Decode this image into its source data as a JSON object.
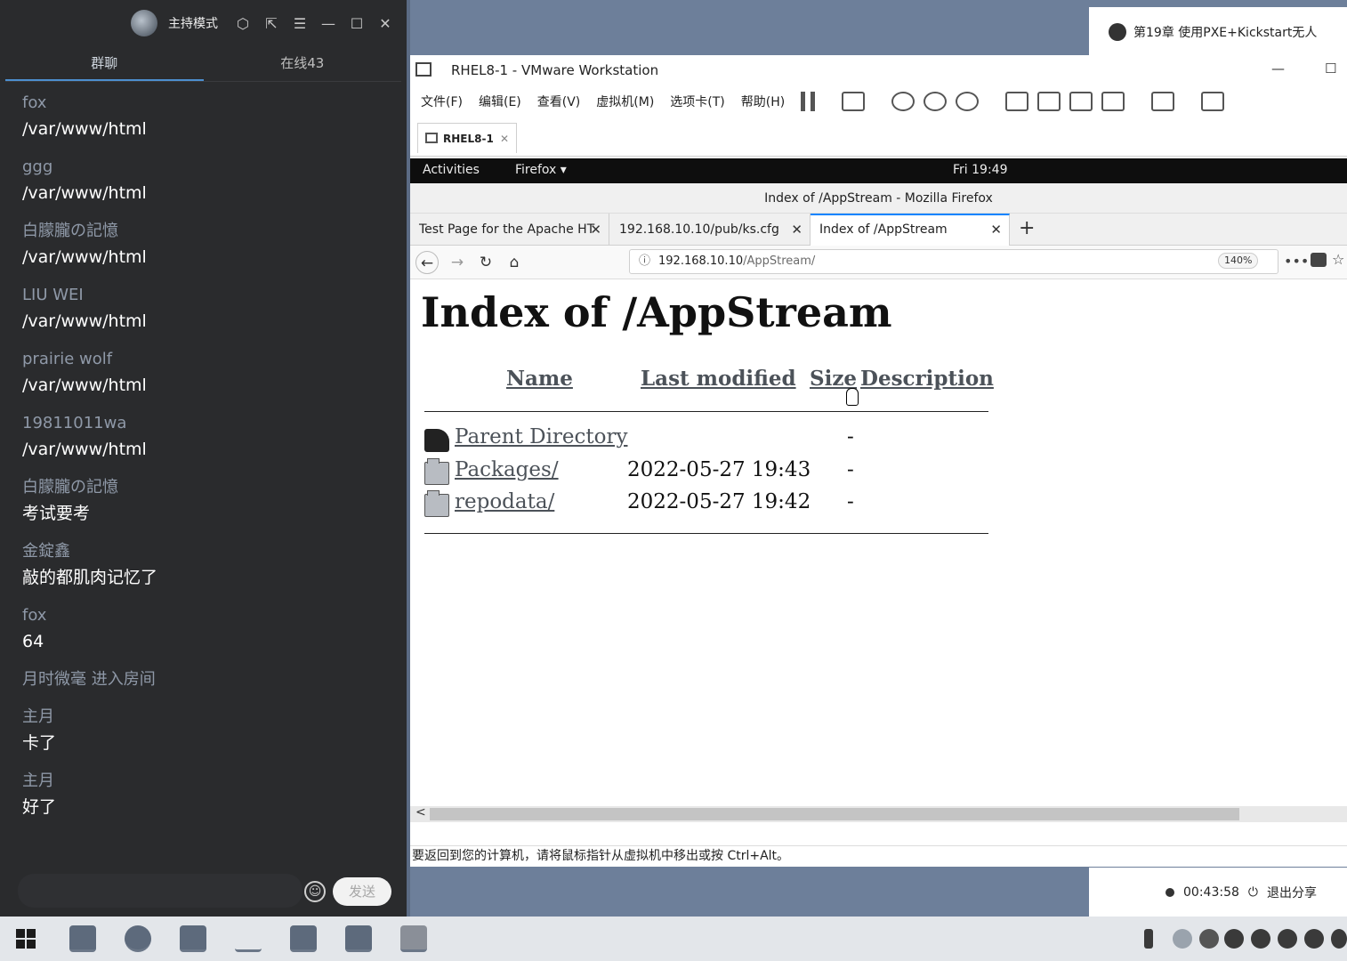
{
  "chat": {
    "host_mode": "主持模式",
    "tabs": [
      "群聊",
      "在线43"
    ],
    "messages": [
      {
        "user": "fox",
        "text": "/var/www/html"
      },
      {
        "user": "ggg",
        "text": "/var/www/html"
      },
      {
        "user": "白朦朧の記憶",
        "text": "/var/www/html"
      },
      {
        "user": "LIU WEI",
        "text": "/var/www/html"
      },
      {
        "user": "prairie wolf",
        "text": "/var/www/html"
      },
      {
        "user": "19811011wa",
        "text": "/var/www/html"
      },
      {
        "user": "白朦朧の記憶",
        "text": "考试要考"
      },
      {
        "user": "金錠鑫",
        "text": "敲的都肌肉记忆了"
      },
      {
        "user": "fox",
        "text": "64"
      }
    ],
    "system_message": "月时微毫 进入房间",
    "messages_after": [
      {
        "user": "主月",
        "text": "卡了"
      },
      {
        "user": "主月",
        "text": "好了"
      }
    ],
    "send_label": "发送"
  },
  "notification": {
    "text": "第19章 使用PXE+Kickstart无人"
  },
  "vmware": {
    "title": "RHEL8-1 - VMware Workstation",
    "menu": [
      "文件(F)",
      "编辑(E)",
      "查看(V)",
      "虚拟机(M)",
      "选项卡(T)",
      "帮助(H)"
    ],
    "vm_tab": "RHEL8-1",
    "hint": "要返回到您的计算机，请将鼠标指针从虚拟机中移出或按 Ctrl+Alt。"
  },
  "gnome": {
    "activities": "Activities",
    "app": "Firefox ▾",
    "clock": "Fri 19:49"
  },
  "firefox": {
    "window_title": "Index of /AppStream - Mozilla Firefox",
    "tabs": [
      {
        "label": "Test Page for the Apache HT"
      },
      {
        "label": "192.168.10.10/pub/ks.cfg"
      },
      {
        "label": "Index of /AppStream"
      }
    ],
    "url_host": "192.168.10.10",
    "url_path": "/AppStream/",
    "zoom": "140%"
  },
  "listing": {
    "heading": "Index of /AppStream",
    "columns": {
      "name": "Name",
      "modified": "Last modified",
      "size": "Size",
      "description": "Description"
    },
    "rows": [
      {
        "name": "Parent Directory",
        "modified": "",
        "size": "-"
      },
      {
        "name": "Packages/",
        "modified": "2022-05-27 19:43",
        "size": "-"
      },
      {
        "name": "repodata/",
        "modified": "2022-05-27 19:42",
        "size": "-"
      }
    ]
  },
  "share": {
    "timer": "00:43:58",
    "stop": "退出分享"
  }
}
